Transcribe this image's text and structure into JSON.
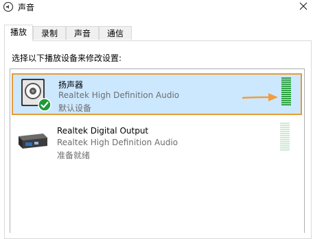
{
  "window": {
    "title": "声音",
    "close_glyph": "✕"
  },
  "tabs": [
    {
      "label": "播放",
      "active": true
    },
    {
      "label": "录制",
      "active": false
    },
    {
      "label": "声音",
      "active": false
    },
    {
      "label": "通信",
      "active": false
    }
  ],
  "instruction": "选择以下播放设备来修改设置:",
  "devices": [
    {
      "name": "扬声器",
      "description": "Realtek High Definition Audio",
      "status": "默认设备",
      "icon": "speaker-icon",
      "default_badge_icon": "checkmark-icon",
      "selected": true,
      "level_bars_active": 14,
      "level_bars_total": 14
    },
    {
      "name": "Realtek Digital Output",
      "description": "Realtek High Definition Audio",
      "status": "准备就绪",
      "icon": "digital-output-icon",
      "selected": false,
      "level_bars_active": 0,
      "level_bars_total": 14
    }
  ],
  "colors": {
    "selection_bg": "#cce8ff",
    "highlight_border": "#e69a35",
    "annotation_arrow": "#f39c3d",
    "meter_active": "#2ea043",
    "meter_inactive": "#cfe8d4",
    "default_badge": "#1e9a3a"
  },
  "annotation": {
    "arrow_icon": "orange-arrow-icon"
  }
}
